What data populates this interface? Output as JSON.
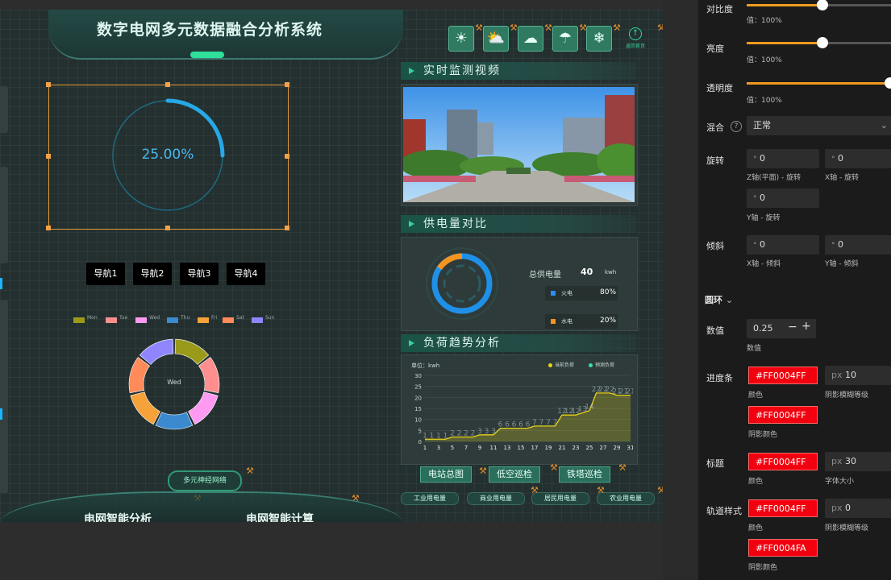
{
  "header": {
    "title": "数字电网多元数据融合分析系统",
    "back_label": "返回首页"
  },
  "weather_icons": [
    "sun-icon",
    "partly-cloudy-icon",
    "cloud-icon",
    "rain-cloud-icon",
    "snow-cloud-icon"
  ],
  "gauge": {
    "value_text": "25.00%",
    "progress": 0.25,
    "color": "#28a8e6"
  },
  "nav": [
    "导航1",
    "导航2",
    "导航3",
    "导航4"
  ],
  "donut": {
    "center_label": "Wed",
    "legend": [
      "Mon",
      "Tue",
      "Wed",
      "Thu",
      "Fri",
      "Sat",
      "Sun"
    ],
    "colors": [
      "#9a9a1a",
      "#ff8f8f",
      "#ff9af2",
      "#3b8ad0",
      "#f5a23a",
      "#ff8a5a",
      "#8f86ff"
    ]
  },
  "panels": {
    "video": {
      "title": "实时监测视频"
    },
    "supply": {
      "title": "供电量对比",
      "total_label": "总供电量",
      "total_value": "40",
      "unit": "kwh",
      "rows": [
        {
          "name": "火电",
          "value": "80%",
          "color": "#2a8df5"
        },
        {
          "name": "水电",
          "value": "20%",
          "color": "#f59520"
        }
      ]
    },
    "trend": {
      "title": "负荷趋势分析",
      "unit_label": "单位：kwh",
      "legend": [
        "当前负荷",
        "预测负荷"
      ],
      "legend_colors": [
        "#e8d41a",
        "#35e0a8"
      ]
    }
  },
  "chart_data": {
    "type": "area",
    "title": "负荷趋势分析",
    "xlabel": "",
    "ylabel": "单位：kwh",
    "x": [
      1,
      2,
      3,
      4,
      5,
      6,
      7,
      8,
      9,
      10,
      11,
      12,
      13,
      14,
      15,
      16,
      17,
      18,
      19,
      20,
      21,
      22,
      23,
      24,
      25,
      26,
      27,
      28,
      29,
      30,
      31
    ],
    "x_ticks": [
      "1",
      "3",
      "5",
      "7",
      "9",
      "11",
      "13",
      "15",
      "17",
      "19",
      "21",
      "23",
      "25",
      "27",
      "29",
      "31"
    ],
    "y_ticks": [
      "0",
      "5",
      "10",
      "15",
      "20",
      "25",
      "30"
    ],
    "ylim": [
      0,
      30
    ],
    "series": [
      {
        "name": "当前负荷",
        "values": [
          1,
          1,
          1,
          1,
          2,
          2,
          2,
          2,
          3,
          3,
          3,
          6,
          6,
          6,
          6,
          6,
          7,
          7,
          7,
          7,
          12,
          12,
          12,
          13,
          14,
          22,
          22,
          22,
          21,
          21,
          21
        ]
      }
    ]
  },
  "bottom_buttons": [
    "电站总图",
    "低空巡检",
    "铁塔巡检"
  ],
  "small_buttons": [
    "工业用电量",
    "商业用电量",
    "居民用电量",
    "农业用电量"
  ],
  "bottom_widget": "多元神经网络",
  "bottom_tabs": [
    "电网智能分析",
    "电网智能计算"
  ],
  "props": {
    "contrast": {
      "label": "对比度",
      "value": "值：100%",
      "level": 1.0
    },
    "brightness": {
      "label": "亮度",
      "value": "值：100%",
      "level": 1.0
    },
    "opacity": {
      "label": "透明度",
      "value": "值：100%",
      "level": 1.0
    },
    "blend": {
      "label": "混合",
      "value": "正常"
    },
    "rotate": {
      "label": "旋转",
      "z": "0",
      "z_label": "Z轴(平面) - 旋转",
      "x": "0",
      "x_label": "X轴 - 旋转",
      "y": "0",
      "y_label": "Y轴 - 旋转"
    },
    "tilt": {
      "label": "倾斜",
      "x": "0",
      "x_label": "X轴 - 倾斜",
      "y": "0",
      "y_label": "Y轴 - 倾斜"
    },
    "ring_section": "圆环",
    "number": {
      "label": "数值",
      "value": "0.25",
      "sub": "数值"
    },
    "progress_bar": {
      "label": "进度条",
      "color": "#FF0004FF",
      "color_sub": "颜色",
      "blur": "10",
      "blur_unit": "px",
      "blur_sub": "阴影模糊等级",
      "shadow": "#FF0004FF",
      "shadow_sub": "阴影颜色"
    },
    "title": {
      "label": "标题",
      "color": "#FF0004FF",
      "color_sub": "颜色",
      "size": "30",
      "size_unit": "px",
      "size_sub": "字体大小"
    },
    "track": {
      "label": "轨道样式",
      "color": "#FF0004FF",
      "color_sub": "颜色",
      "blur": "0",
      "blur_unit": "px",
      "blur_sub": "阴影模糊等级",
      "shadow": "#FF0004FA",
      "shadow_sub": "阴影颜色"
    }
  }
}
